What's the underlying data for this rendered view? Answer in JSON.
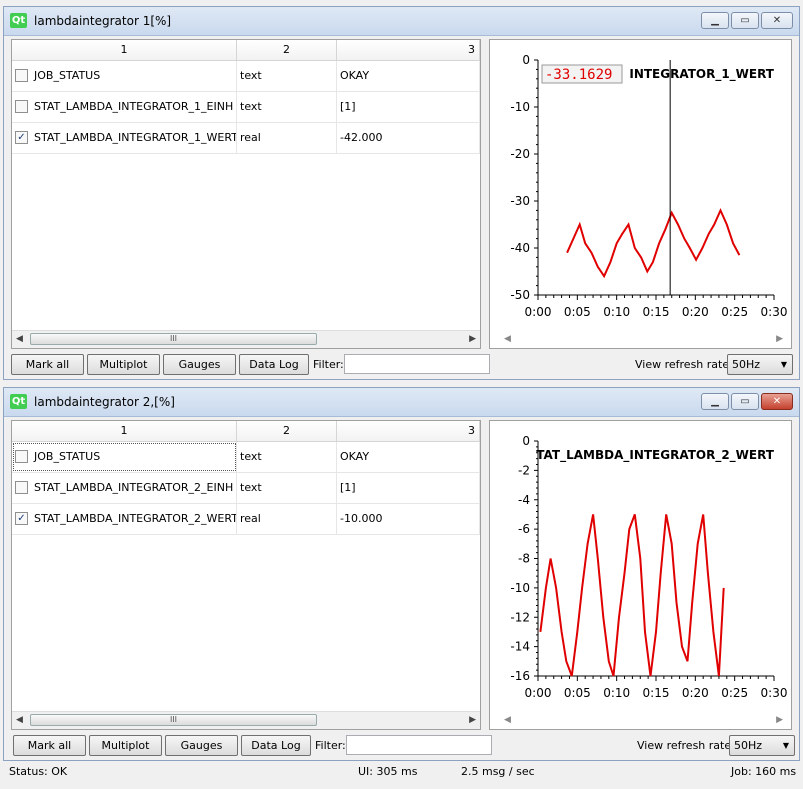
{
  "windows": [
    {
      "title": "lambdaintegrator 1[%]",
      "columns": [
        "1",
        "2",
        "3"
      ],
      "rows": [
        {
          "checked": false,
          "check_mark": "",
          "name": "JOB_STATUS",
          "type": "text",
          "value": "OKAY"
        },
        {
          "checked": false,
          "check_mark": "",
          "name": "STAT_LAMBDA_INTEGRATOR_1_EINH",
          "type": "text",
          "value": "[1]"
        },
        {
          "checked": true,
          "check_mark": "✓",
          "name": "STAT_LAMBDA_INTEGRATOR_1_WERT",
          "type": "real",
          "value": "-42.000"
        }
      ],
      "plot": {
        "title": "INTEGRATOR_1_WERT",
        "cursor_readout": "-33.1629",
        "y_ticks": [
          "0",
          "-10",
          "-20",
          "-30",
          "-40",
          "-50"
        ],
        "x_ticks": [
          "0:00",
          "0:05",
          "0:10",
          "0:15",
          "0:20",
          "0:25",
          "0:30"
        ]
      },
      "buttons": {
        "mark_all": "Mark all",
        "multiplot": "Multiplot",
        "gauges": "Gauges",
        "data_log": "Data Log"
      },
      "filter_label": "Filter:",
      "filter_value": "",
      "refresh_label": "View refresh rate:",
      "refresh_value": "50Hz"
    },
    {
      "title": "lambdaintegrator 2,[%]",
      "columns": [
        "1",
        "2",
        "3"
      ],
      "rows": [
        {
          "checked": false,
          "check_mark": "",
          "name": "JOB_STATUS",
          "type": "text",
          "value": "OKAY"
        },
        {
          "checked": false,
          "check_mark": "",
          "name": "STAT_LAMBDA_INTEGRATOR_2_EINH",
          "type": "text",
          "value": "[1]"
        },
        {
          "checked": true,
          "check_mark": "✓",
          "name": "STAT_LAMBDA_INTEGRATOR_2_WERT",
          "type": "real",
          "value": "-10.000"
        }
      ],
      "plot": {
        "title": "TAT_LAMBDA_INTEGRATOR_2_WERT",
        "y_ticks": [
          "0",
          "-2",
          "-4",
          "-6",
          "-8",
          "-10",
          "-12",
          "-14",
          "-16"
        ],
        "x_ticks": [
          "0:00",
          "0:05",
          "0:10",
          "0:15",
          "0:20",
          "0:25",
          "0:30"
        ]
      },
      "buttons": {
        "mark_all": "Mark all",
        "multiplot": "Multiplot",
        "gauges": "Gauges",
        "data_log": "Data Log"
      },
      "filter_label": "Filter:",
      "filter_value": "",
      "refresh_label": "View refresh rate:",
      "refresh_value": "50Hz"
    }
  ],
  "chart_data": [
    {
      "type": "line",
      "title": "INTEGRATOR_1_WERT",
      "xlabel": "",
      "ylabel": "",
      "xlim": [
        0,
        30
      ],
      "ylim": [
        -50,
        0
      ],
      "x_unit": "seconds",
      "series_color": "#e00000",
      "cursor": {
        "x": 16.8,
        "value": -33.1629
      },
      "series": [
        {
          "x": [
            3.7,
            4.5,
            5.3,
            6.0,
            6.8,
            7.6,
            8.4,
            9.2,
            10.0,
            10.7,
            11.5,
            12.3,
            13.1,
            13.9,
            14.6,
            15.4,
            16.2,
            17.0,
            17.8,
            18.6,
            19.3,
            20.1,
            20.9,
            21.7,
            22.4,
            23.2,
            24.0,
            24.8,
            25.6
          ],
          "y": [
            -41,
            -38,
            -35,
            -39,
            -41,
            -44,
            -46,
            -43,
            -39,
            -37,
            -35,
            -40,
            -42,
            -45,
            -43,
            -39,
            -36,
            -32.5,
            -35,
            -38,
            -40,
            -42.5,
            -40,
            -37,
            -35,
            -32,
            -35,
            -39,
            -41.5
          ]
        }
      ]
    },
    {
      "type": "line",
      "title": "TAT_LAMBDA_INTEGRATOR_2_WERT",
      "xlabel": "",
      "ylabel": "",
      "xlim": [
        0,
        30
      ],
      "ylim": [
        -16,
        0
      ],
      "x_unit": "seconds",
      "series_color": "#e00000",
      "series": [
        {
          "x": [
            0.3,
            1.0,
            1.6,
            2.3,
            3.0,
            3.6,
            4.3,
            5.0,
            5.6,
            6.3,
            7.0,
            7.6,
            8.3,
            9.0,
            9.6,
            10.3,
            11.0,
            11.6,
            12.3,
            13.0,
            13.6,
            14.3,
            15.0,
            15.6,
            16.3,
            17.0,
            17.6,
            18.3,
            19.0,
            19.6,
            20.3,
            21.0,
            21.6,
            22.3,
            23.0,
            23.6
          ],
          "y": [
            -13,
            -10,
            -8,
            -10,
            -13,
            -15,
            -16,
            -13,
            -10,
            -7,
            -5,
            -8,
            -12,
            -15,
            -16,
            -12,
            -9,
            -6,
            -5,
            -8,
            -13,
            -16,
            -13,
            -9,
            -5,
            -7,
            -11,
            -14,
            -15,
            -11,
            -7,
            -5,
            -9,
            -13,
            -16,
            -10
          ]
        }
      ]
    }
  ],
  "status": {
    "status_text": "Status: OK",
    "ui_text": "UI:  305 ms",
    "rate_text": "2.5 msg / sec",
    "job_text": "Job:  160 ms"
  }
}
